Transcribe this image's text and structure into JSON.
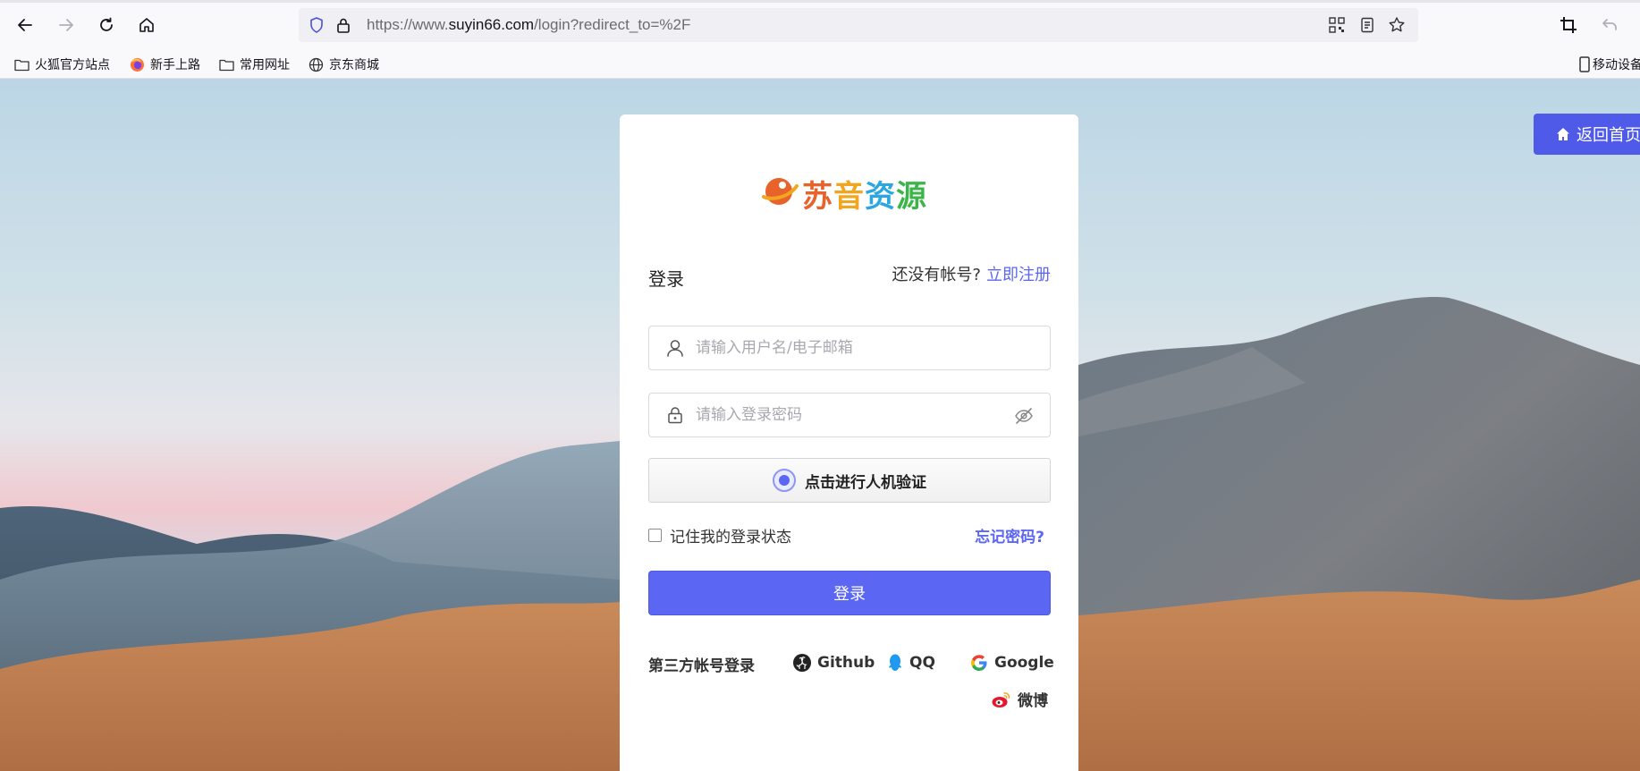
{
  "browser": {
    "url_prefix": "https://www.",
    "url_domain": "suyin66.com",
    "url_path": "/login?redirect_to=%2F",
    "bookmarks": [
      "火狐官方站点",
      "新手上路",
      "常用网址",
      "京东商城"
    ],
    "mobile_label": "移动设备"
  },
  "page": {
    "home_button": "返回首页",
    "logo_text": "苏音资源",
    "login_heading": "登录",
    "no_account": "还没有帐号?",
    "register_link": "立即注册",
    "username_placeholder": "请输入用户名/电子邮箱",
    "password_placeholder": "请输入登录密码",
    "captcha_label": "点击进行人机验证",
    "remember_label": "记住我的登录状态",
    "forgot_link": "忘记密码?",
    "login_button": "登录",
    "third_party_label": "第三方帐号登录",
    "providers": [
      "Github",
      "QQ",
      "Google",
      "微博"
    ]
  },
  "colors": {
    "accent": "#5b67f2",
    "logo_chars": [
      "#e8622c",
      "#f2a51f",
      "#2aa6e0",
      "#3bb54a"
    ]
  }
}
